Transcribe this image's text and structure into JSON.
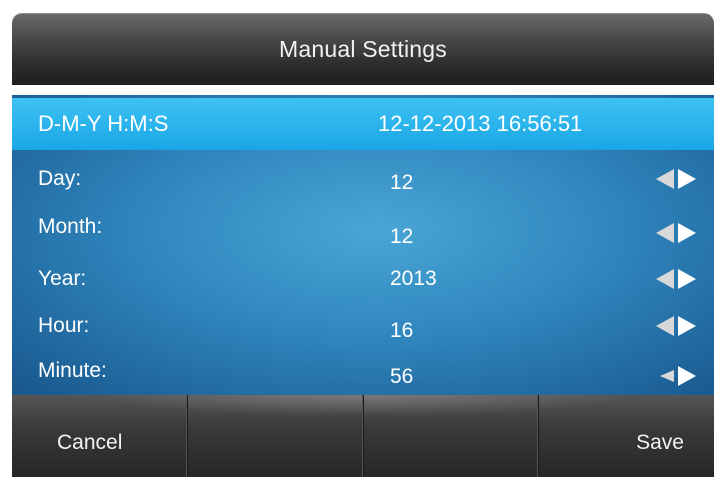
{
  "title": "Manual Settings",
  "header": {
    "label": "D-M-Y H:M:S",
    "value": "12-12-2013 16:56:51"
  },
  "fields": [
    {
      "label": "Day:",
      "value": "12"
    },
    {
      "label": "Month:",
      "value": "12"
    },
    {
      "label": "Year:",
      "value": "2013"
    },
    {
      "label": "Hour:",
      "value": "16"
    },
    {
      "label": "Minute:",
      "value": "56"
    }
  ],
  "softkeys": {
    "left": "Cancel",
    "slot2": "",
    "slot3": "",
    "right": "Save"
  },
  "colors": {
    "highlight": "#1aa6e6",
    "body": "#2f86bd",
    "bar": "#2e2e2e"
  }
}
